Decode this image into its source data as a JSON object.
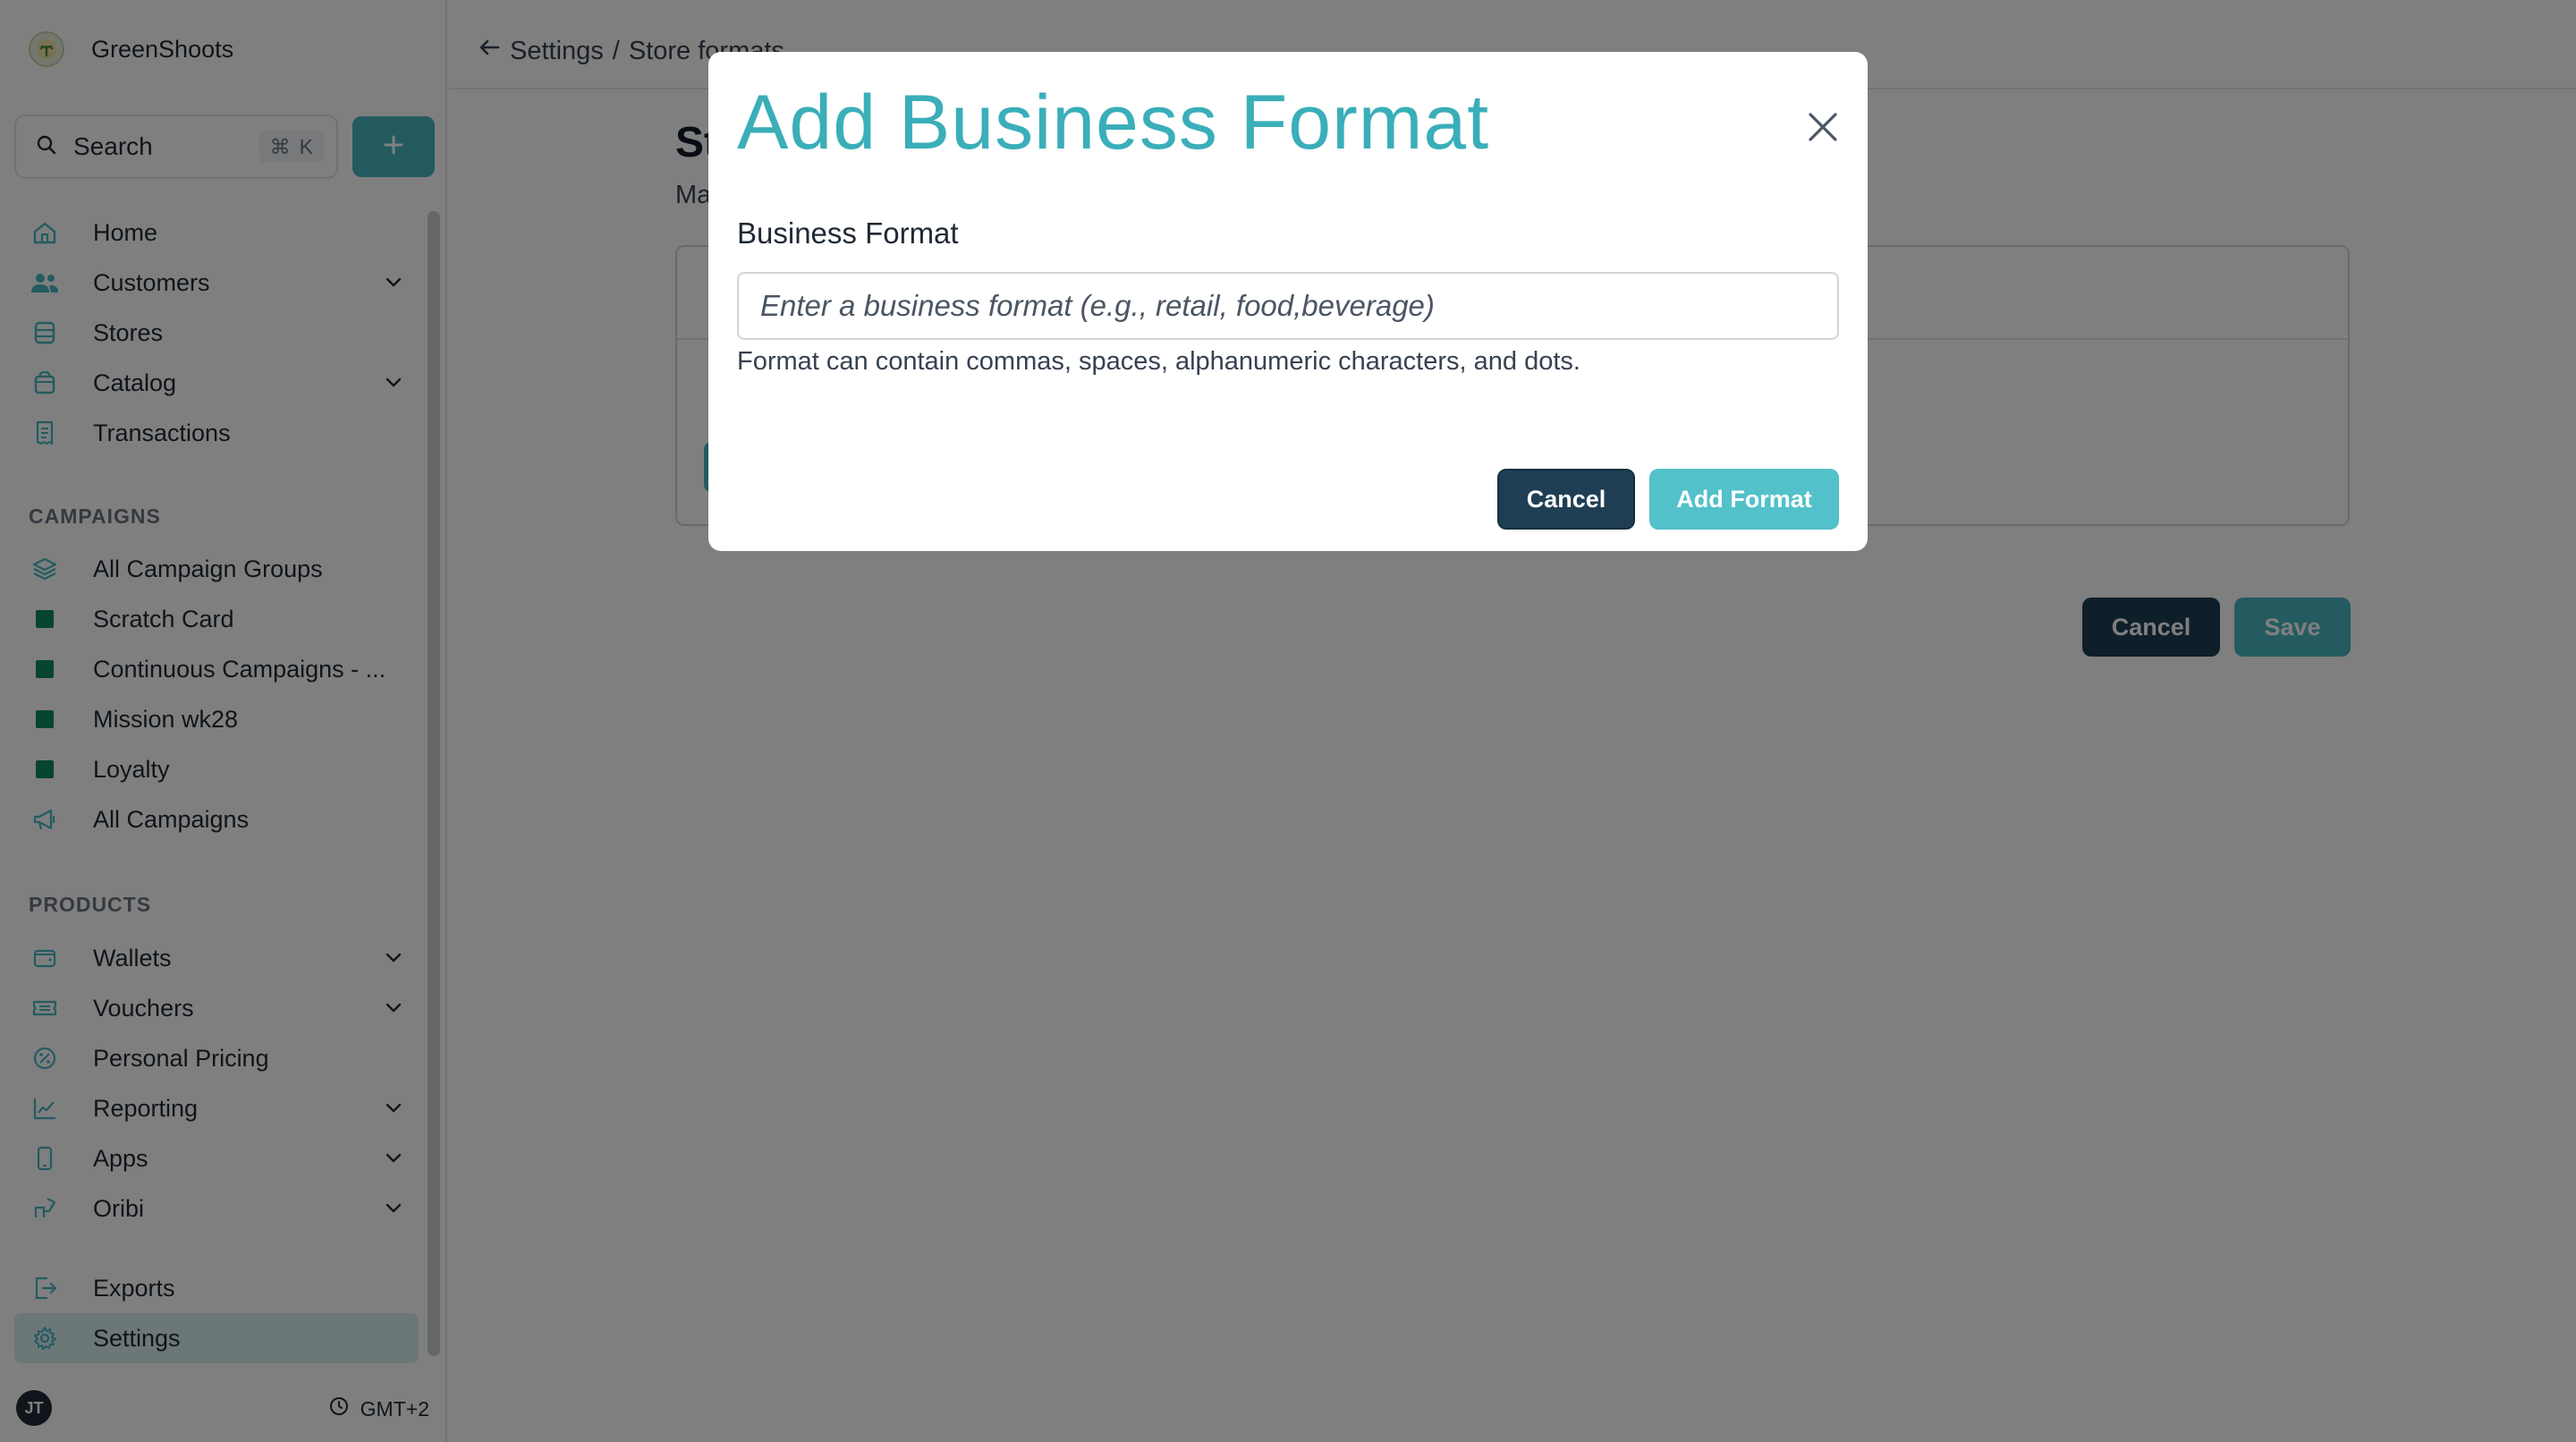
{
  "app": {
    "name": "GreenShoots"
  },
  "search": {
    "label": "Search",
    "shortcut_symbol": "⌘",
    "shortcut_key": "K"
  },
  "sidebar": {
    "main_items": [
      {
        "label": "Home",
        "icon": "home-icon",
        "has_chevron": false
      },
      {
        "label": "Customers",
        "icon": "users-icon",
        "has_chevron": true
      },
      {
        "label": "Stores",
        "icon": "database-icon",
        "has_chevron": false
      },
      {
        "label": "Catalog",
        "icon": "bag-icon",
        "has_chevron": true
      },
      {
        "label": "Transactions",
        "icon": "receipt-icon",
        "has_chevron": false
      }
    ],
    "campaigns_title": "CAMPAIGNS",
    "campaign_items": [
      {
        "label": "All Campaign Groups",
        "icon": "layers-icon"
      },
      {
        "label": "Scratch Card",
        "icon": "square-icon"
      },
      {
        "label": "Continuous Campaigns - ...",
        "icon": "square-icon"
      },
      {
        "label": "Mission wk28",
        "icon": "square-icon"
      },
      {
        "label": "Loyalty",
        "icon": "square-icon"
      },
      {
        "label": "All Campaigns",
        "icon": "megaphone-icon"
      }
    ],
    "products_title": "PRODUCTS",
    "product_items": [
      {
        "label": "Wallets",
        "icon": "wallet-icon",
        "has_chevron": true
      },
      {
        "label": "Vouchers",
        "icon": "ticket-icon",
        "has_chevron": true
      },
      {
        "label": "Personal Pricing",
        "icon": "percent-icon",
        "has_chevron": false
      },
      {
        "label": "Reporting",
        "icon": "chart-line-icon",
        "has_chevron": true
      },
      {
        "label": "Apps",
        "icon": "phone-icon",
        "has_chevron": true
      },
      {
        "label": "Oribi",
        "icon": "plug-icon",
        "has_chevron": true
      }
    ],
    "bottom_items": [
      {
        "label": "Exports",
        "icon": "export-icon"
      },
      {
        "label": "Settings",
        "icon": "gear-icon",
        "active": true
      }
    ],
    "user_initials": "JT",
    "timezone": "GMT+2"
  },
  "breadcrumb": {
    "parent": "Settings",
    "separator": "/",
    "current": "Store formats"
  },
  "page": {
    "title_partial": "St",
    "subtitle_partial": "Ma",
    "cancel_label": "Cancel",
    "save_label": "Save"
  },
  "modal": {
    "title": "Add Business Format",
    "field_label": "Business Format",
    "field_value": "",
    "field_placeholder": "Enter a business format (e.g., retail, food,beverage)",
    "help_text": "Format can contain commas, spaces, alphanumeric characters, and dots.",
    "cancel_label": "Cancel",
    "add_label": "Add Format"
  },
  "colors": {
    "accent": "#47b7c1",
    "dark_button": "#1f3e53",
    "brand_green": "#0f8a5f",
    "overlay": "rgba(0,0,0,0.5)"
  }
}
